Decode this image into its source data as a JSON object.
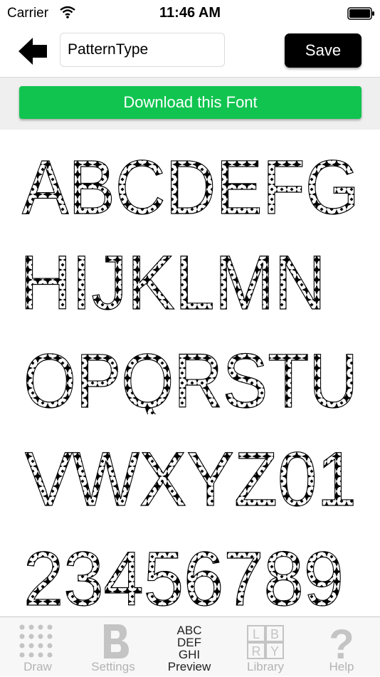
{
  "status": {
    "carrier": "Carrier",
    "time": "11:46 AM"
  },
  "toolbar": {
    "font_name": "PatternType",
    "save_label": "Save"
  },
  "download_label": "Download this Font",
  "preview": {
    "rows": [
      "ABCDEFG",
      "HIJKLMN",
      "OPQRSTU",
      "VWXYZ01",
      "23456789"
    ]
  },
  "tabs": [
    {
      "label": "Draw",
      "icon": "dot-grid-icon",
      "active": false
    },
    {
      "label": "Settings",
      "icon": "letter-b-icon",
      "active": false
    },
    {
      "label": "Preview",
      "icon": "abc-grid-icon",
      "active": true,
      "icon_text": [
        "ABC",
        "DEF",
        "GHI"
      ]
    },
    {
      "label": "Library",
      "icon": "library-grid-icon",
      "active": false,
      "icon_text": [
        "L",
        "B",
        "R",
        "Y"
      ]
    },
    {
      "label": "Help",
      "icon": "question-mark-icon",
      "active": false,
      "icon_text": [
        "?"
      ]
    }
  ],
  "colors": {
    "accent_green": "#11c450",
    "save_bg": "#000000",
    "inactive_tab": "#b3b3b3"
  }
}
